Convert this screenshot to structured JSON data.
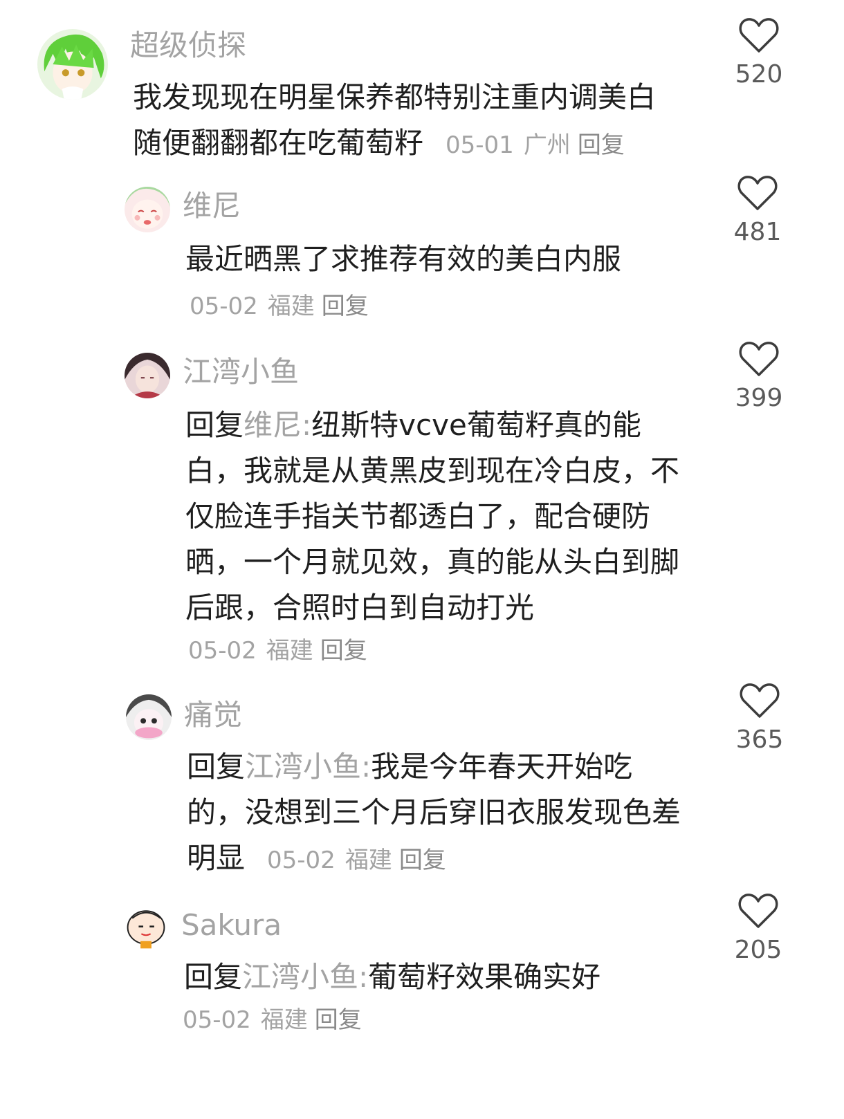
{
  "comments": [
    {
      "username": "超级侦探",
      "reply_prefix": "",
      "mention": "",
      "text": "我发现现在明星保养都特别注重内调美白随便翻翻都在吃葡萄籽",
      "line1": "我发现现在明星保养都特别注重内调美白",
      "line2": "随便翻翻都在吃葡萄籽",
      "date": "05-01",
      "location": "广州",
      "reply_label": "回复",
      "likes": "520"
    },
    {
      "username": "维尼",
      "text": "最近晒黑了求推荐有效的美白内服",
      "date": "05-02",
      "location": "福建",
      "reply_label": "回复",
      "likes": "481"
    },
    {
      "username": "江湾小鱼",
      "reply_prefix": "回复",
      "mention": "维尼:",
      "text": "纽斯特vcve葡萄籽真的能白，我就是从黄黑皮到现在冷白皮，不仅脸连手指关节都透白了，配合硬防晒，一个月就见效，真的能从头白到脚后跟，合照时白到自动打光",
      "date": "05-02",
      "location": "福建",
      "reply_label": "回复",
      "likes": "399"
    },
    {
      "username": "痛觉",
      "reply_prefix": "回复",
      "mention": "江湾小鱼:",
      "text": "我是今年春天开始吃的，没想到三个月后穿旧衣服发现色差明显",
      "date": "05-02",
      "location": "福建",
      "reply_label": "回复",
      "likes": "365"
    },
    {
      "username": "Sakura",
      "reply_prefix": "回复",
      "mention": "江湾小鱼:",
      "text": "葡萄籽效果确实好",
      "date": "05-02",
      "location": "福建",
      "reply_label": "回复",
      "likes": "205"
    }
  ],
  "icons": {
    "like": "heart-outline-icon"
  },
  "colors": {
    "text": "#1f1f1f",
    "muted": "#a3a3a3",
    "background": "#ffffff"
  }
}
